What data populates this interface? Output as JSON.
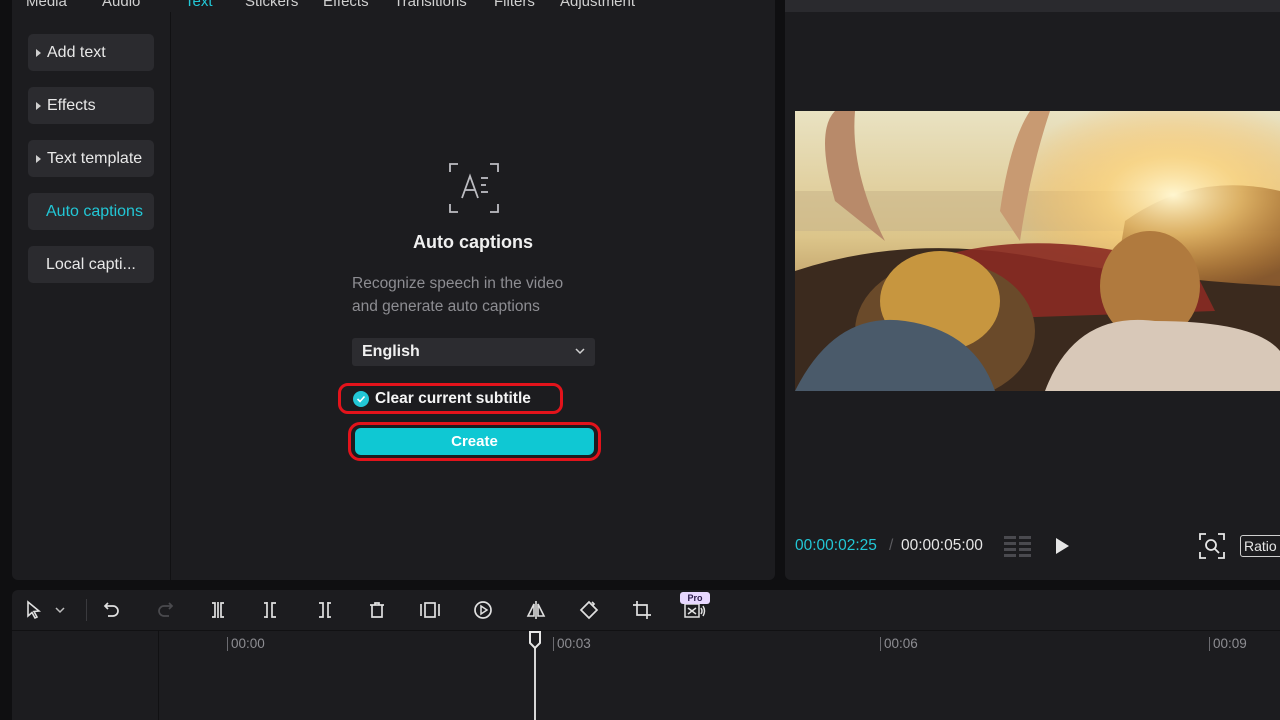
{
  "top_tabs": [
    "Media",
    "Audio",
    "Text",
    "Stickers",
    "Effects",
    "Transitions",
    "Filters",
    "Adjustment"
  ],
  "active_tab": "Text",
  "sidebar": {
    "items": [
      {
        "label": "Add text"
      },
      {
        "label": "Effects"
      },
      {
        "label": "Text template"
      },
      {
        "label": "Auto captions"
      },
      {
        "label": "Local capti..."
      }
    ]
  },
  "auto_captions": {
    "title": "Auto captions",
    "desc_line1": "Recognize speech in the video",
    "desc_line2": "and generate auto captions",
    "language": "English",
    "clear_label": "Clear current subtitle",
    "clear_checked": true,
    "create_label": "Create"
  },
  "player": {
    "current_time": "00:00:02:25",
    "separator": "/",
    "total_time": "00:00:05:00",
    "ratio_label": "Ratio"
  },
  "timeline": {
    "ticks": [
      "00:00",
      "00:03",
      "00:06",
      "00:09"
    ],
    "pro_badge": "Pro"
  },
  "colors": {
    "accent": "#22c7d6",
    "highlight": "#e3131b",
    "panel": "#1c1c1f",
    "background": "#0f0f11"
  }
}
